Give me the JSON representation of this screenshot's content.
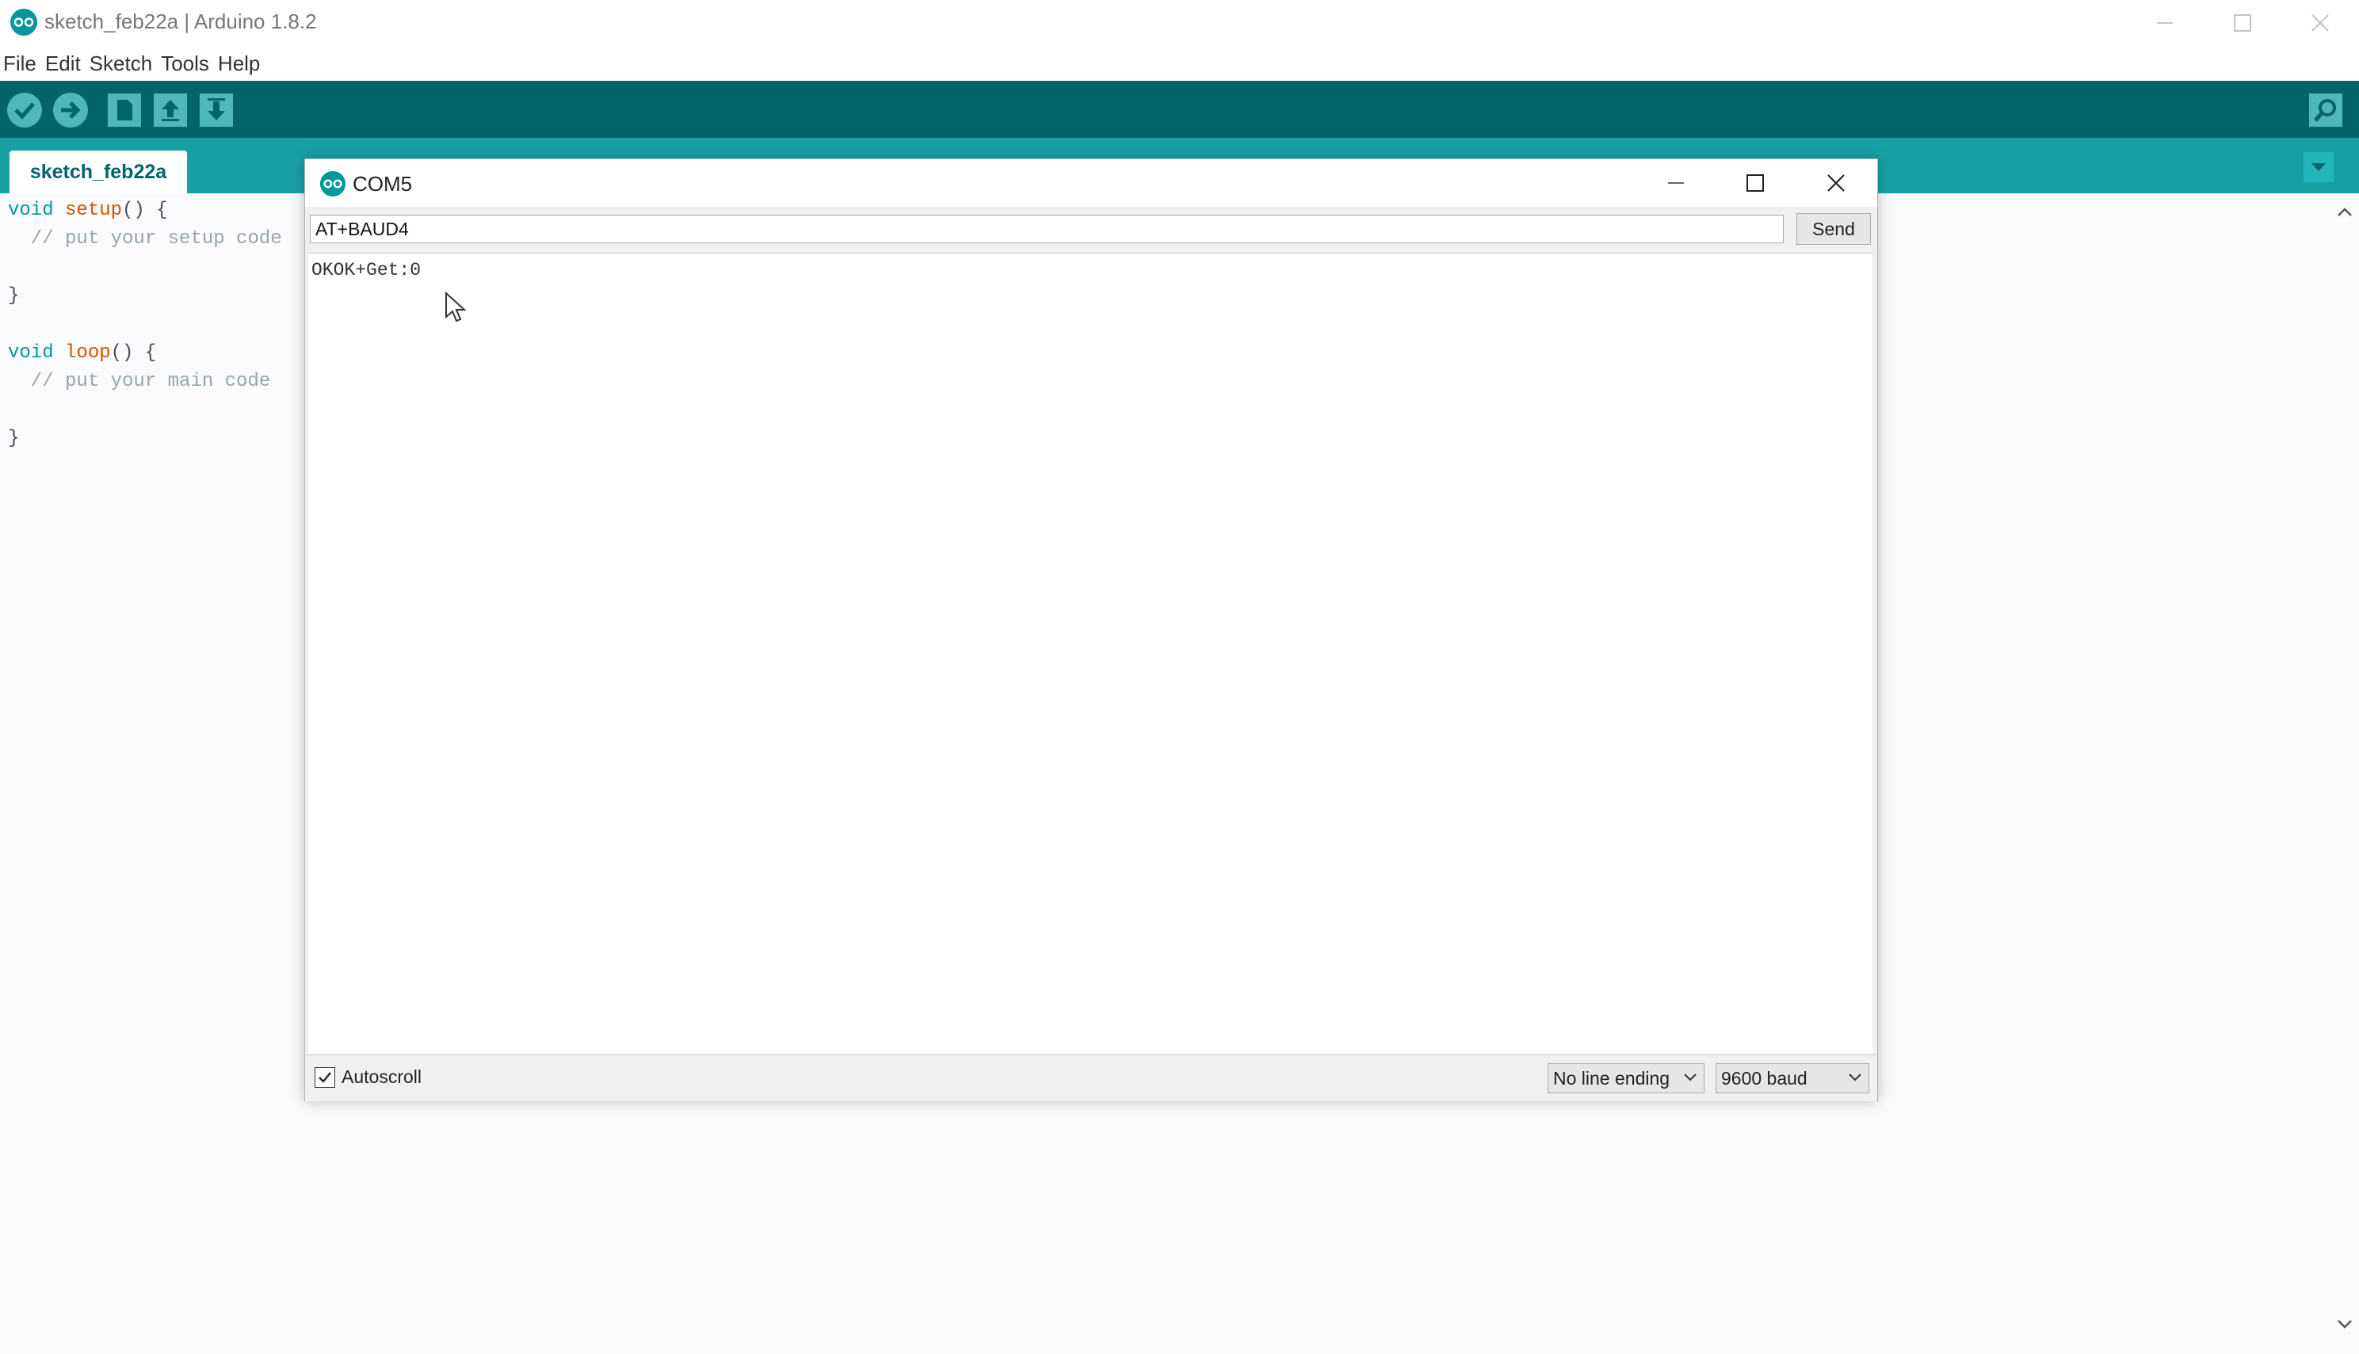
{
  "window": {
    "title": "sketch_feb22a | Arduino 1.8.2"
  },
  "menu": {
    "items": [
      "File",
      "Edit",
      "Sketch",
      "Tools",
      "Help"
    ]
  },
  "toolbar": {
    "buttons": [
      "verify-icon",
      "upload-icon",
      "new-icon",
      "open-icon",
      "save-icon"
    ],
    "right_button": "serial-monitor-icon",
    "background": "#006468"
  },
  "tabs": {
    "active": "sketch_feb22a",
    "background": "#17a1a5"
  },
  "editor": {
    "line1_kw": "void",
    "line1_fn": "setup",
    "line1_rest": "() {",
    "line2": "  // put your setup code",
    "line3": "}",
    "line4_kw": "void",
    "line4_fn": "loop",
    "line4_rest": "() {",
    "line5": "  // put your main code",
    "line6": "}"
  },
  "serial_monitor": {
    "title": "COM5",
    "input_value": "AT+BAUD4",
    "send_label": "Send",
    "output": "OKOK+Get:0",
    "autoscroll_label": "Autoscroll",
    "autoscroll_checked": true,
    "line_ending": "No line ending",
    "baud": "9600 baud"
  }
}
